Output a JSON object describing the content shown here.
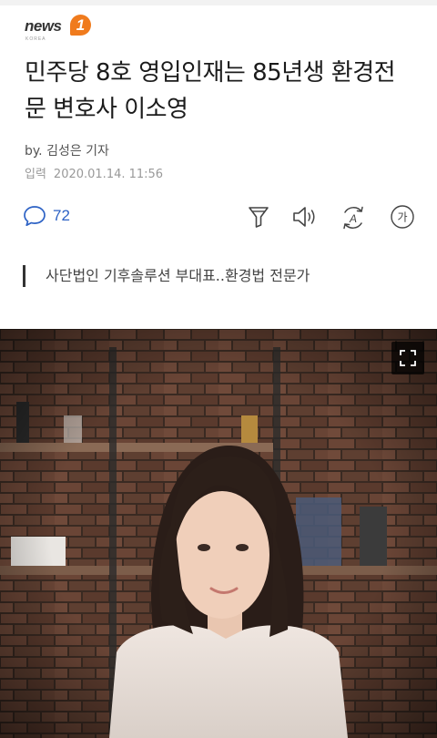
{
  "logo": {
    "word": "news",
    "digit": "1",
    "sub": "KOREA"
  },
  "article": {
    "title": "민주당 8호 영입인재는 85년생 환경전문 변호사 이소영",
    "byline": "by. 김성은 기자",
    "date_label": "입력",
    "date_value": "2020.01.14. 11:56",
    "summary": "사단법인 기후솔루션 부대표..환경법 전문가"
  },
  "actions": {
    "comment_count": "72",
    "icons": [
      "comment-icon",
      "filter-icon",
      "speaker-icon",
      "translate-icon",
      "font-size-icon"
    ],
    "font_button_label": "가",
    "translate_label": "A"
  },
  "colors": {
    "accent": "#2d62c5",
    "brand_orange": "#f07b1d"
  },
  "photo": {
    "expand_icon": "expand-icon"
  }
}
